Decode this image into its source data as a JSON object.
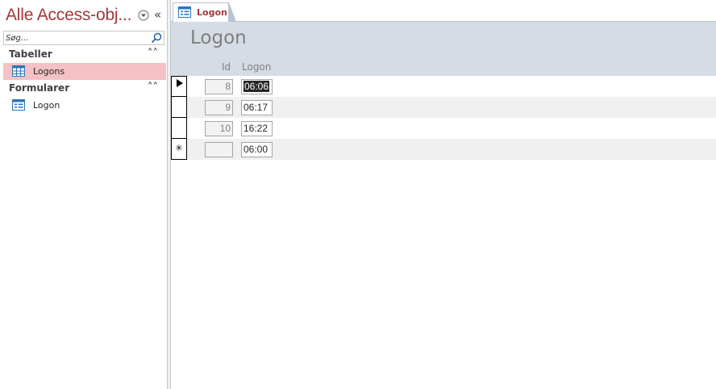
{
  "nav": {
    "title": "Alle Access-obj...",
    "search_placeholder": "Søg...",
    "groups": [
      {
        "label": "Tabeller",
        "items": [
          {
            "label": "Logons",
            "icon": "table-icon",
            "selected": true
          }
        ]
      },
      {
        "label": "Formularer",
        "items": [
          {
            "label": "Logon",
            "icon": "form-icon",
            "selected": false
          }
        ]
      }
    ],
    "collapse_glyph": "«",
    "group_chevron": "⌃"
  },
  "tab": {
    "label": "Logon",
    "icon": "form-icon"
  },
  "form": {
    "title": "Logon",
    "columns": {
      "id": "Id",
      "logon": "Logon"
    },
    "records": [
      {
        "id": "8",
        "logon": "06:06",
        "current": true
      },
      {
        "id": "9",
        "logon": "06:17",
        "current": false
      },
      {
        "id": "10",
        "logon": "16:22",
        "current": false
      }
    ],
    "new_record": {
      "id": "",
      "logon": "06:00",
      "selector_glyph": "✳"
    }
  },
  "colors": {
    "accent": "#a4373a",
    "selection": "#f5c1c4",
    "header_band": "#d6dce5"
  }
}
